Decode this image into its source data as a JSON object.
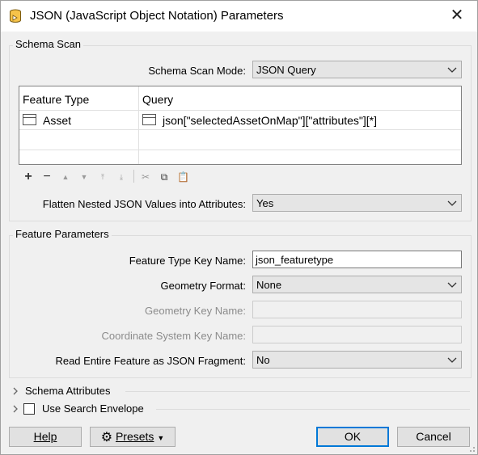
{
  "window": {
    "title": "JSON (JavaScript Object Notation) Parameters"
  },
  "schema_scan": {
    "group_label": "Schema Scan",
    "mode_label": "Schema Scan Mode:",
    "mode_value": "JSON Query",
    "table": {
      "columns": [
        "Feature Type",
        "Query"
      ],
      "rows": [
        {
          "feature_type": "Asset",
          "query": "json[\"selectedAssetOnMap\"][\"attributes\"][*]"
        }
      ]
    },
    "flatten_label": "Flatten Nested JSON Values into Attributes:",
    "flatten_value": "Yes"
  },
  "feature_parameters": {
    "group_label": "Feature Parameters",
    "type_key_label": "Feature Type Key Name:",
    "type_key_value": "json_featuretype",
    "geometry_format_label": "Geometry Format:",
    "geometry_format_value": "None",
    "geometry_key_label": "Geometry Key Name:",
    "coord_sys_label": "Coordinate System Key Name:",
    "read_entire_label": "Read Entire Feature as JSON Fragment:",
    "read_entire_value": "No"
  },
  "schema_attributes": {
    "label": "Schema Attributes"
  },
  "search_envelope": {
    "label": "Use Search Envelope",
    "checked": false
  },
  "buttons": {
    "help": "Help",
    "presets": "Presets",
    "ok": "OK",
    "cancel": "Cancel"
  },
  "toolbar_icons": [
    "add-icon",
    "remove-icon",
    "move-up-icon",
    "move-down-icon",
    "move-top-icon",
    "move-bottom-icon",
    "cut-icon",
    "copy-icon",
    "paste-icon"
  ],
  "colors": {
    "accent": "#0078d7",
    "window_bg": "#f0f0f0"
  }
}
